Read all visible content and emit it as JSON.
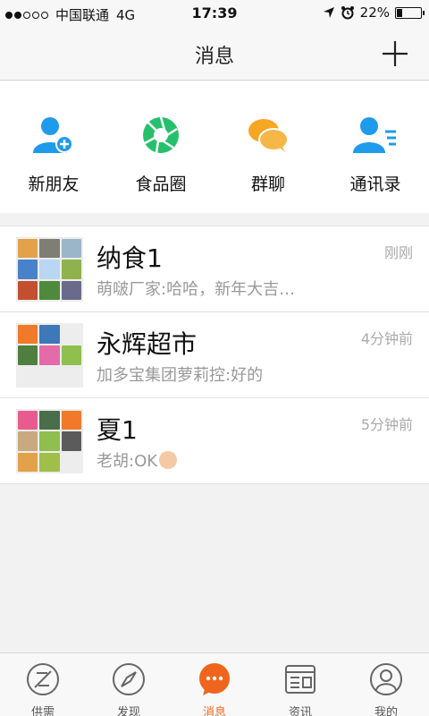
{
  "status": {
    "carrier": "中国联通",
    "network": "4G",
    "time": "17:39",
    "battery_text": "22%",
    "battery_level": 0.22
  },
  "nav": {
    "title": "消息",
    "add_icon": "plus-icon"
  },
  "shortcuts": [
    {
      "label": "新朋友",
      "icon": "add-friend-icon",
      "color": "#1e9bea"
    },
    {
      "label": "食品圈",
      "icon": "aperture-icon",
      "color": "#25c06b"
    },
    {
      "label": "群聊",
      "icon": "chat-bubbles-icon",
      "color": "#f5a623"
    },
    {
      "label": "通讯录",
      "icon": "contacts-icon",
      "color": "#1e9bea"
    }
  ],
  "chats": [
    {
      "name": "纳食1",
      "message": "萌啵厂家:哈哈，新年大吉…",
      "time": "刚刚",
      "tiles": [
        "#e2a24a",
        "#7e7e74",
        "#9cb6c9",
        "#4a82c9",
        "#b9d6f2",
        "#8fb24c",
        "#c2502e",
        "#4f8a3c",
        "#6a6a8a"
      ]
    },
    {
      "name": "永辉超市",
      "message": "加多宝集团萝莉控:好的",
      "time": "4分钟前",
      "tiles": [
        "#f07a2a",
        "#3d78b8",
        "#ededed",
        "#4f7f3e",
        "#e46aa8",
        "#8fbf4c",
        "#ededed",
        "#ededed",
        "#ededed"
      ]
    },
    {
      "name": "夏1",
      "message": "老胡:OK",
      "time": "5分钟前",
      "tiles": [
        "#e95b8e",
        "#4a6e4a",
        "#f07a2a",
        "#c9a97f",
        "#8fbf4c",
        "#5b5b5b",
        "#e2a24a",
        "#9fbf4a",
        "#ededed"
      ]
    }
  ],
  "tabs": [
    {
      "label": "供需",
      "icon": "supply-icon",
      "active": false
    },
    {
      "label": "发现",
      "icon": "compass-icon",
      "active": false
    },
    {
      "label": "消息",
      "icon": "message-icon",
      "active": true
    },
    {
      "label": "资讯",
      "icon": "news-icon",
      "active": false
    },
    {
      "label": "我的",
      "icon": "profile-icon",
      "active": false
    }
  ],
  "colors": {
    "accent": "#f0651e",
    "blue": "#1e9bea",
    "green": "#25c06b",
    "orange": "#f5a623"
  }
}
